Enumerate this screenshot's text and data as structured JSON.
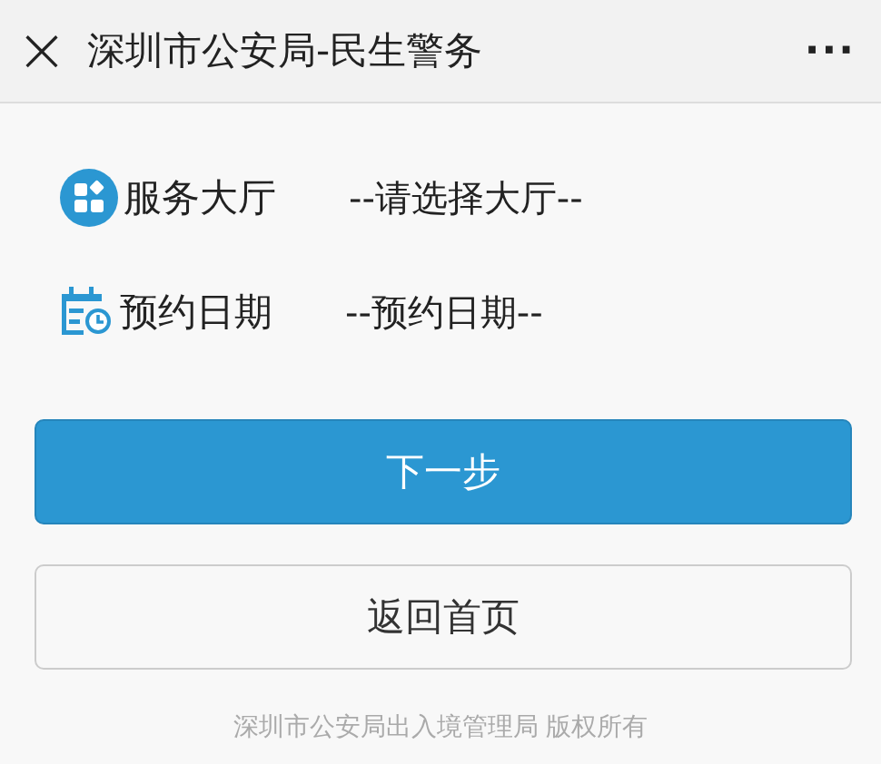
{
  "header": {
    "close": "×",
    "title": "深圳市公安局-民生警务",
    "more": "···"
  },
  "fields": [
    {
      "kind": "hall",
      "label": "服务大厅",
      "placeholder": "--请选择大厅--"
    },
    {
      "kind": "date",
      "label": "预约日期",
      "placeholder": "--预约日期--"
    }
  ],
  "buttons": [
    {
      "kind": "primary",
      "label": "下一步"
    },
    {
      "kind": "secondary",
      "label": "返回首页"
    }
  ],
  "footer": "深圳市公安局出入境管理局 版权所有"
}
